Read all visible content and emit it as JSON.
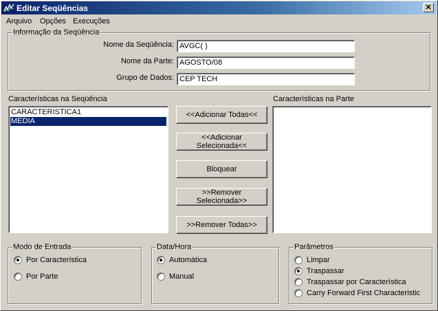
{
  "window": {
    "title": "Editar Seqüências",
    "close_glyph": "✕"
  },
  "menu": {
    "items": [
      "Arquivo",
      "Opções",
      "Execuções"
    ]
  },
  "info": {
    "legend": "Informação da Seqüência",
    "sequence_name_label": "Nome da Seqüência:",
    "sequence_name_value": "AVGC( )",
    "part_name_label": "Nome da Parte:",
    "part_name_value": "AGOSTO/08",
    "data_group_label": "Grupo de Dados:",
    "data_group_value": "CEP TECH"
  },
  "lists": {
    "sequence_label": "Características na Seqüência",
    "sequence_items": [
      "CARACTERISTICA1",
      "MEDIA"
    ],
    "sequence_selected_index": 1,
    "part_label": "Características na Parte",
    "part_items": []
  },
  "buttons": {
    "add_all": "<<Adicionar Todas<<",
    "add_selected": "<<Adicionar Selecionada<<",
    "block": "Bloquear",
    "remove_selected": ">>Remover Selecionada>>",
    "remove_all": ">>Remover Todas>>"
  },
  "entry_mode": {
    "legend": "Modo de Entrada",
    "options": [
      "Por Característica",
      "Por Parte"
    ],
    "selected": 0
  },
  "datetime": {
    "legend": "Data/Hora",
    "options": [
      "Automática",
      "Manual"
    ],
    "selected": 0
  },
  "params": {
    "legend": "Parâmetros",
    "options": [
      "Limpar",
      "Traspassar",
      "Traspassar por Característica",
      "Carry Forward First Characteristic"
    ],
    "selected": 1
  },
  "icons": {
    "app": "chart-line-icon",
    "close": "close-icon"
  },
  "colors": {
    "title_start": "#0a246a",
    "title_end": "#a6caf0",
    "selection": "#0a246a",
    "face": "#d4d0c8"
  }
}
